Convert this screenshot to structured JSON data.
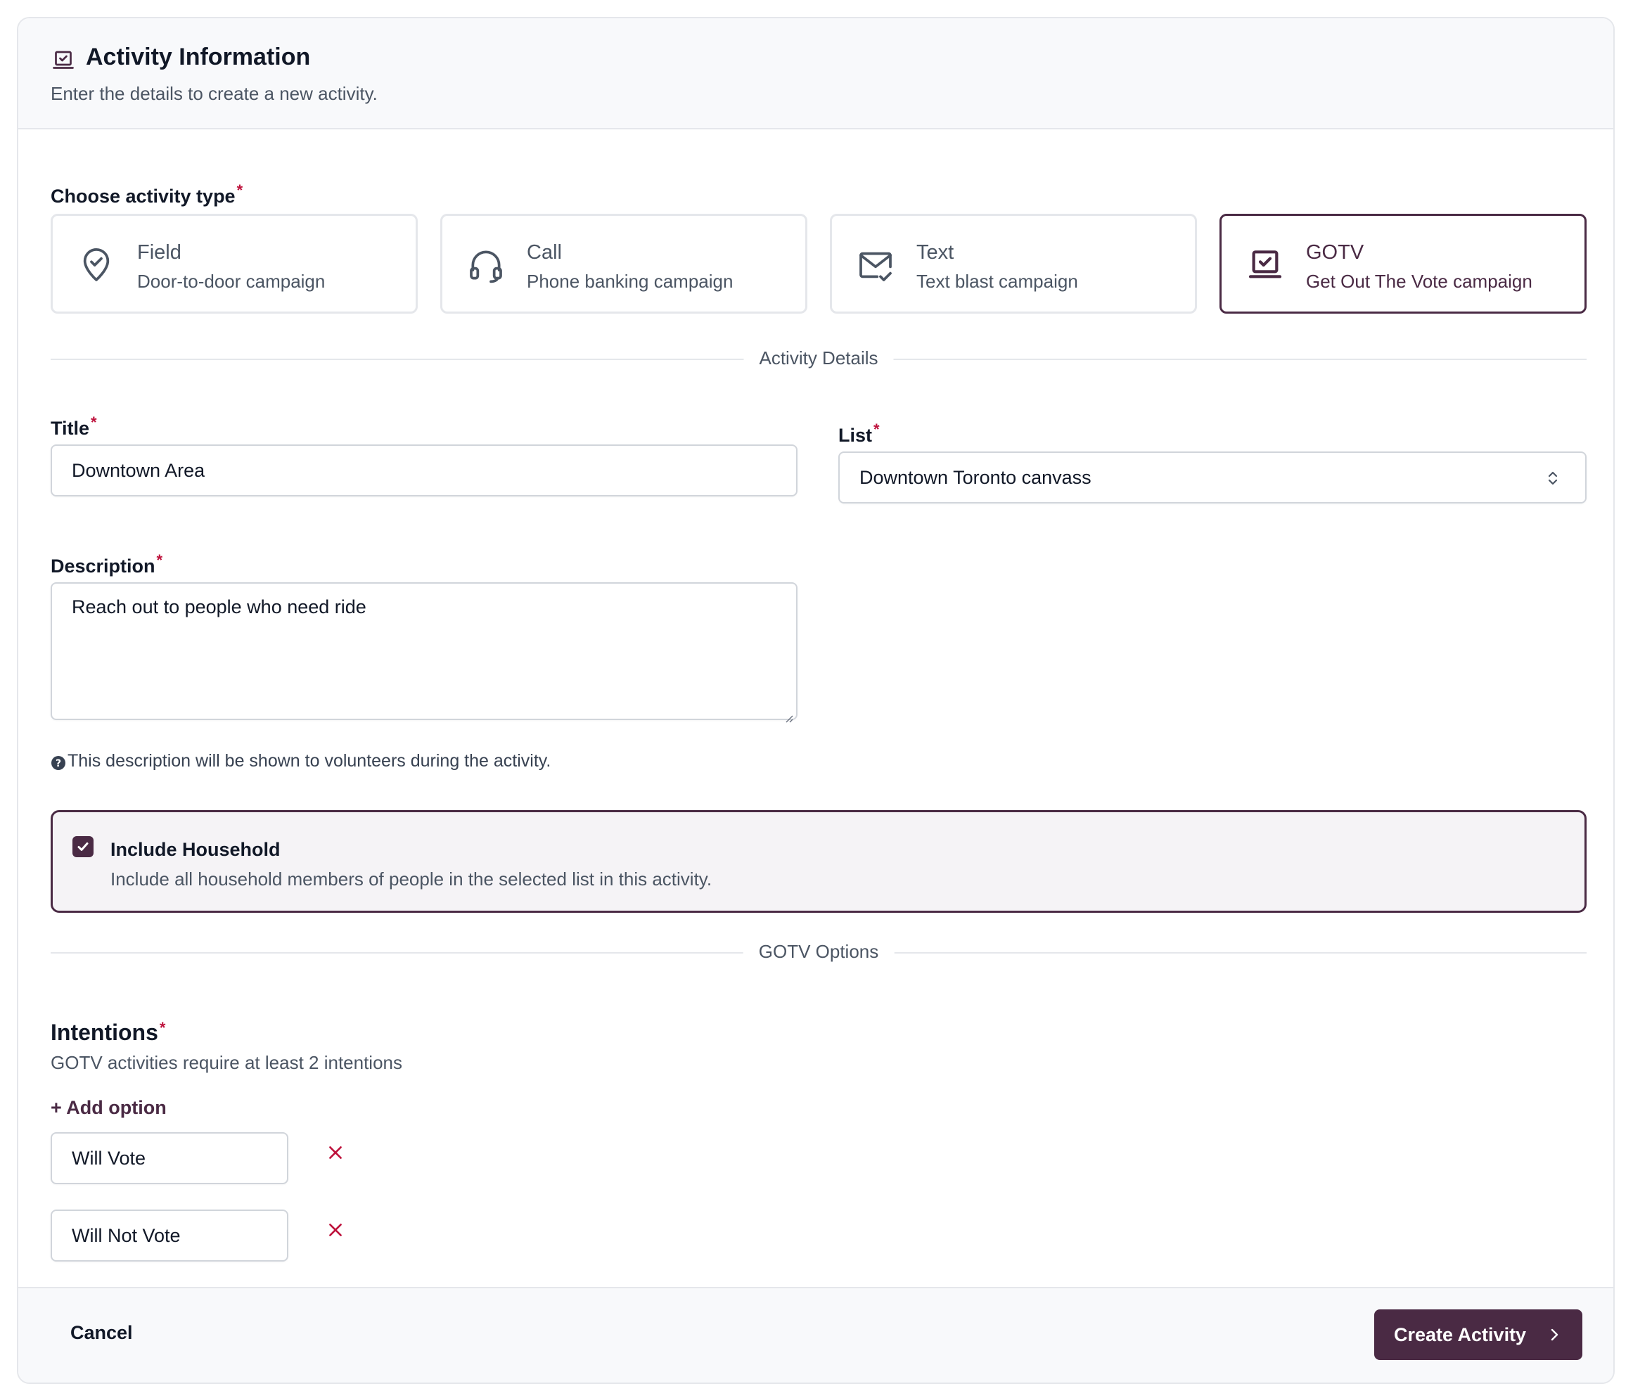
{
  "header": {
    "icon": "laptop-check-icon",
    "title": "Activity Information",
    "subtitle": "Enter the details to create a new activity."
  },
  "activity_type": {
    "label": "Choose activity type",
    "required_mark": "*",
    "selected": "GOTV",
    "options": [
      {
        "name": "Field",
        "description": "Door-to-door campaign",
        "icon": "map-pin-check-icon"
      },
      {
        "name": "Call",
        "description": "Phone banking campaign",
        "icon": "headset-icon"
      },
      {
        "name": "Text",
        "description": "Text blast campaign",
        "icon": "mail-check-icon"
      },
      {
        "name": "GOTV",
        "description": "Get Out The Vote campaign",
        "icon": "laptop-check-icon"
      }
    ]
  },
  "details_divider": "Activity Details",
  "title_field": {
    "label": "Title",
    "required_mark": "*",
    "value": "Downtown Area"
  },
  "list_field": {
    "label": "List",
    "required_mark": "*",
    "value": "Downtown Toronto canvass"
  },
  "description_field": {
    "label": "Description",
    "required_mark": "*",
    "value": "Reach out to people who need ride",
    "hint": "This description will be shown to volunteers during the activity."
  },
  "household": {
    "checked": true,
    "title": "Include Household",
    "description": "Include all household members of people in the selected list in this activity."
  },
  "gotv_divider": "GOTV Options",
  "intentions": {
    "title": "Intentions",
    "required_mark": "*",
    "subtitle": "GOTV activities require at least 2 intentions",
    "add_label": "+ Add option",
    "options": [
      "Will Vote",
      "Will Not Vote"
    ]
  },
  "footer": {
    "cancel_label": "Cancel",
    "submit_label": "Create Activity"
  },
  "colors": {
    "accent": "#4a2a44",
    "danger": "#be123c"
  }
}
